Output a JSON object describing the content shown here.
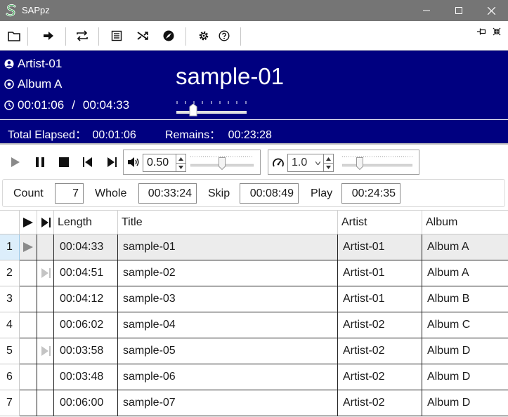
{
  "window": {
    "title": "SAPpz"
  },
  "toolbar": {
    "icons": [
      "folder-icon",
      "arrow-right-icon",
      "repeat-icon",
      "list-icon",
      "shuffle-icon",
      "compass-icon",
      "gear-icon",
      "help-icon"
    ],
    "pin_icon": "pin-icon",
    "collapse_icon": "collapse-icon"
  },
  "now_playing": {
    "artist": "Artist-01",
    "album": "Album A",
    "elapsed": "00:01:06",
    "separator": "/",
    "duration": "00:04:33",
    "title": "sample-01",
    "seek_fraction": 0.24
  },
  "totals": {
    "elapsed_label": "Total Elapsed：",
    "elapsed_value": "00:01:06",
    "remains_label": "Remains：",
    "remains_value": "00:23:28"
  },
  "controls": {
    "volume_value": "0.50",
    "volume_fraction": 0.5,
    "speed_value": "1.0",
    "speed_fraction": 0.25
  },
  "stats": {
    "count_label": "Count",
    "count_value": "7",
    "whole_label": "Whole",
    "whole_value": "00:33:24",
    "skip_label": "Skip",
    "skip_value": "00:08:49",
    "play_label": "Play",
    "play_value": "00:24:35"
  },
  "table": {
    "headers": {
      "length": "Length",
      "title": "Title",
      "artist": "Artist",
      "album": "Album"
    },
    "rows": [
      {
        "num": "1",
        "state": "playing",
        "length": "00:04:33",
        "title": "sample-01",
        "artist": "Artist-01",
        "album": "Album A"
      },
      {
        "num": "2",
        "state": "skip",
        "length": "00:04:51",
        "title": "sample-02",
        "artist": "Artist-01",
        "album": "Album A"
      },
      {
        "num": "3",
        "state": "",
        "length": "00:04:12",
        "title": "sample-03",
        "artist": "Artist-01",
        "album": "Album B"
      },
      {
        "num": "4",
        "state": "",
        "length": "00:06:02",
        "title": "sample-04",
        "artist": "Artist-02",
        "album": "Album C"
      },
      {
        "num": "5",
        "state": "skip",
        "length": "00:03:58",
        "title": "sample-05",
        "artist": "Artist-02",
        "album": "Album D"
      },
      {
        "num": "6",
        "state": "",
        "length": "00:03:48",
        "title": "sample-06",
        "artist": "Artist-02",
        "album": "Album D"
      },
      {
        "num": "7",
        "state": "",
        "length": "00:06:00",
        "title": "sample-07",
        "artist": "Artist-02",
        "album": "Album D"
      }
    ]
  }
}
